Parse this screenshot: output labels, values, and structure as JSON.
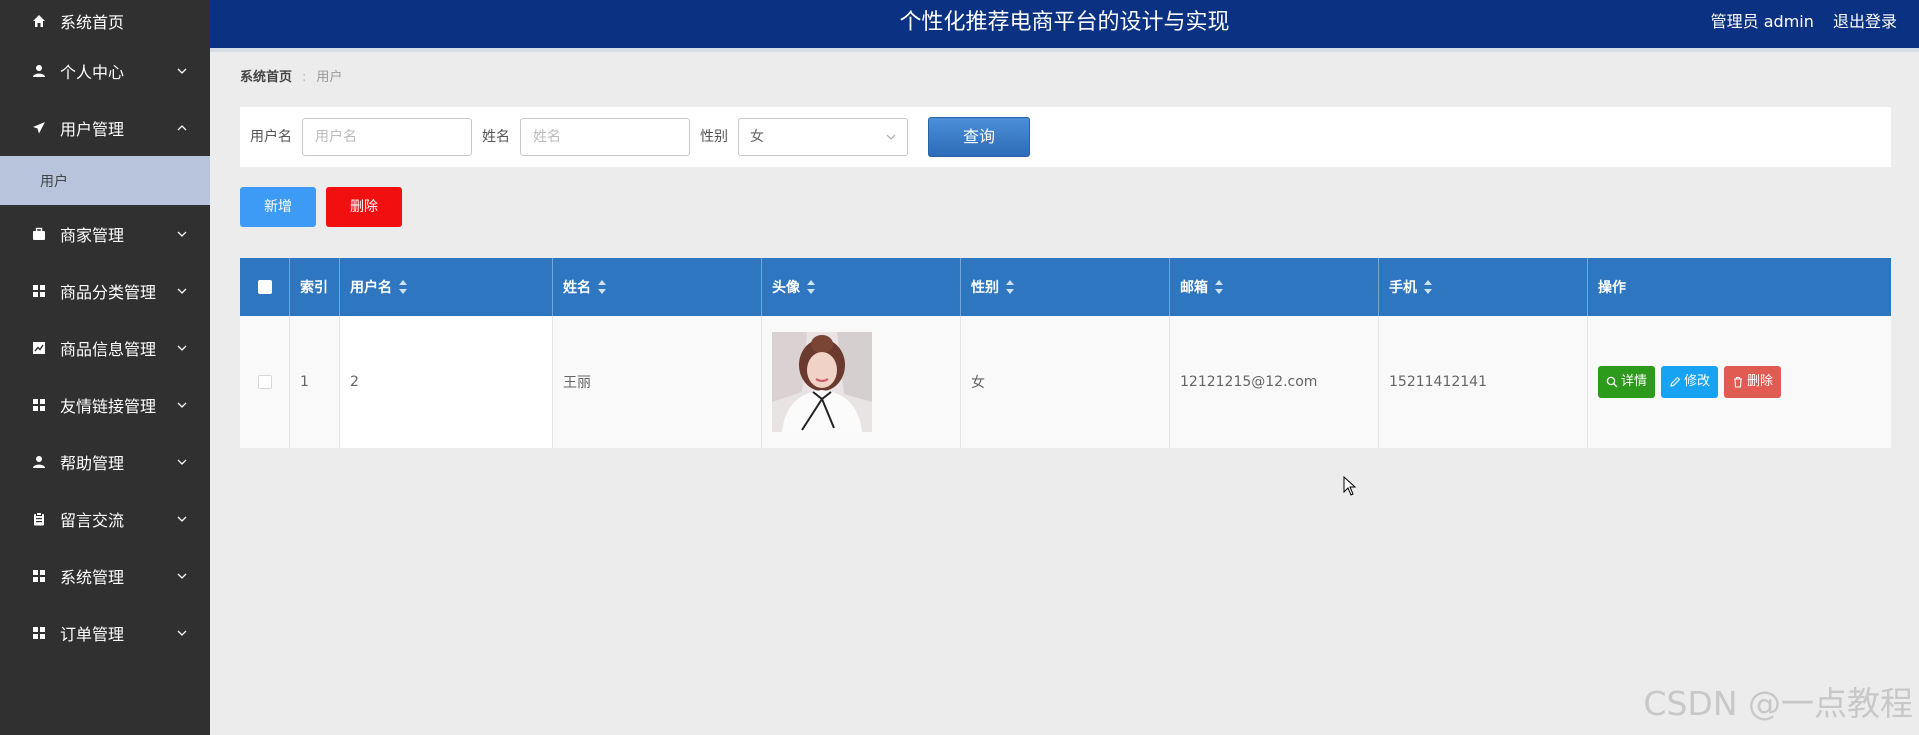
{
  "header": {
    "title": "个性化推荐电商平台的设计与实现",
    "admin_label": "管理员 admin",
    "logout_label": "退出登录"
  },
  "sidebar": {
    "items": [
      {
        "label": "系统首页",
        "icon": "home-icon"
      },
      {
        "label": "个人中心",
        "icon": "user-icon"
      },
      {
        "label": "用户管理",
        "icon": "send-icon",
        "expanded": true
      },
      {
        "label": "商家管理",
        "icon": "briefcase-icon"
      },
      {
        "label": "商品分类管理",
        "icon": "grid-icon"
      },
      {
        "label": "商品信息管理",
        "icon": "chart-icon"
      },
      {
        "label": "友情链接管理",
        "icon": "grid-icon"
      },
      {
        "label": "帮助管理",
        "icon": "user-icon"
      },
      {
        "label": "留言交流",
        "icon": "clipboard-icon"
      },
      {
        "label": "系统管理",
        "icon": "grid-icon"
      },
      {
        "label": "订单管理",
        "icon": "grid-icon"
      }
    ],
    "subitem": {
      "label": "用户"
    }
  },
  "breadcrumb": {
    "home": "系统首页",
    "separator": ":",
    "current": "用户"
  },
  "search": {
    "username_label": "用户名",
    "username_placeholder": "用户名",
    "name_label": "姓名",
    "name_placeholder": "姓名",
    "gender_label": "性别",
    "gender_value": "女",
    "query_label": "查询"
  },
  "actions": {
    "add_label": "新增",
    "delete_label": "删除"
  },
  "table": {
    "headers": [
      "索引",
      "用户名",
      "姓名",
      "头像",
      "性别",
      "邮箱",
      "手机",
      "操作"
    ],
    "rows": [
      {
        "index": "1",
        "username": "2",
        "name": "王丽",
        "gender": "女",
        "email": "12121215@12.com",
        "phone": "15211412141"
      }
    ],
    "op_detail": "详情",
    "op_edit": "修改",
    "op_delete": "删除"
  },
  "watermark": "CSDN @一点教程",
  "colors": {
    "header": "#0b3182",
    "sidebar": "#303030",
    "table_header": "#2e77c0",
    "add": "#3d9bf5",
    "delete": "#f10f0f"
  }
}
